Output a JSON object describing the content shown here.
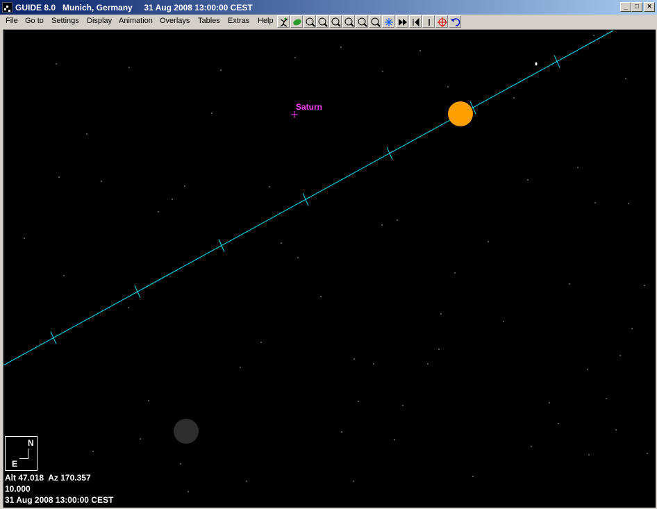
{
  "window": {
    "title": "GUIDE 8.0   Munich, Germany     31 Aug 2008 13:00:00 CEST",
    "minimize": "_",
    "maximize": "□",
    "close": "×"
  },
  "menu": [
    "File",
    "Go to",
    "Settings",
    "Display",
    "Animation",
    "Overlays",
    "Tables",
    "Extras",
    "Help"
  ],
  "toolbar": [
    "running-man-icon",
    "planet-icon",
    "zoom-1-icon",
    "zoom-2-icon",
    "zoom-3-icon",
    "zoom-4-icon",
    "zoom-5-icon",
    "zoom-10-icon",
    "star-chart-icon",
    "fast-forward-icon",
    "step-back-icon",
    "step-forward-icon",
    "target-icon",
    "undo-icon"
  ],
  "chart": {
    "object_label": "Saturn",
    "compass_north": "N",
    "compass_east": "E",
    "status_altaz": "Alt 47.018  Az 170.357",
    "status_field": "10.000",
    "status_time": "31 Aug 2008 13:00:00 CEST"
  },
  "colors": {
    "sun": "#ffa000",
    "moon": "#2e2e2e",
    "ecliptic": "#00e5ff",
    "saturn": "#ff40ff"
  }
}
